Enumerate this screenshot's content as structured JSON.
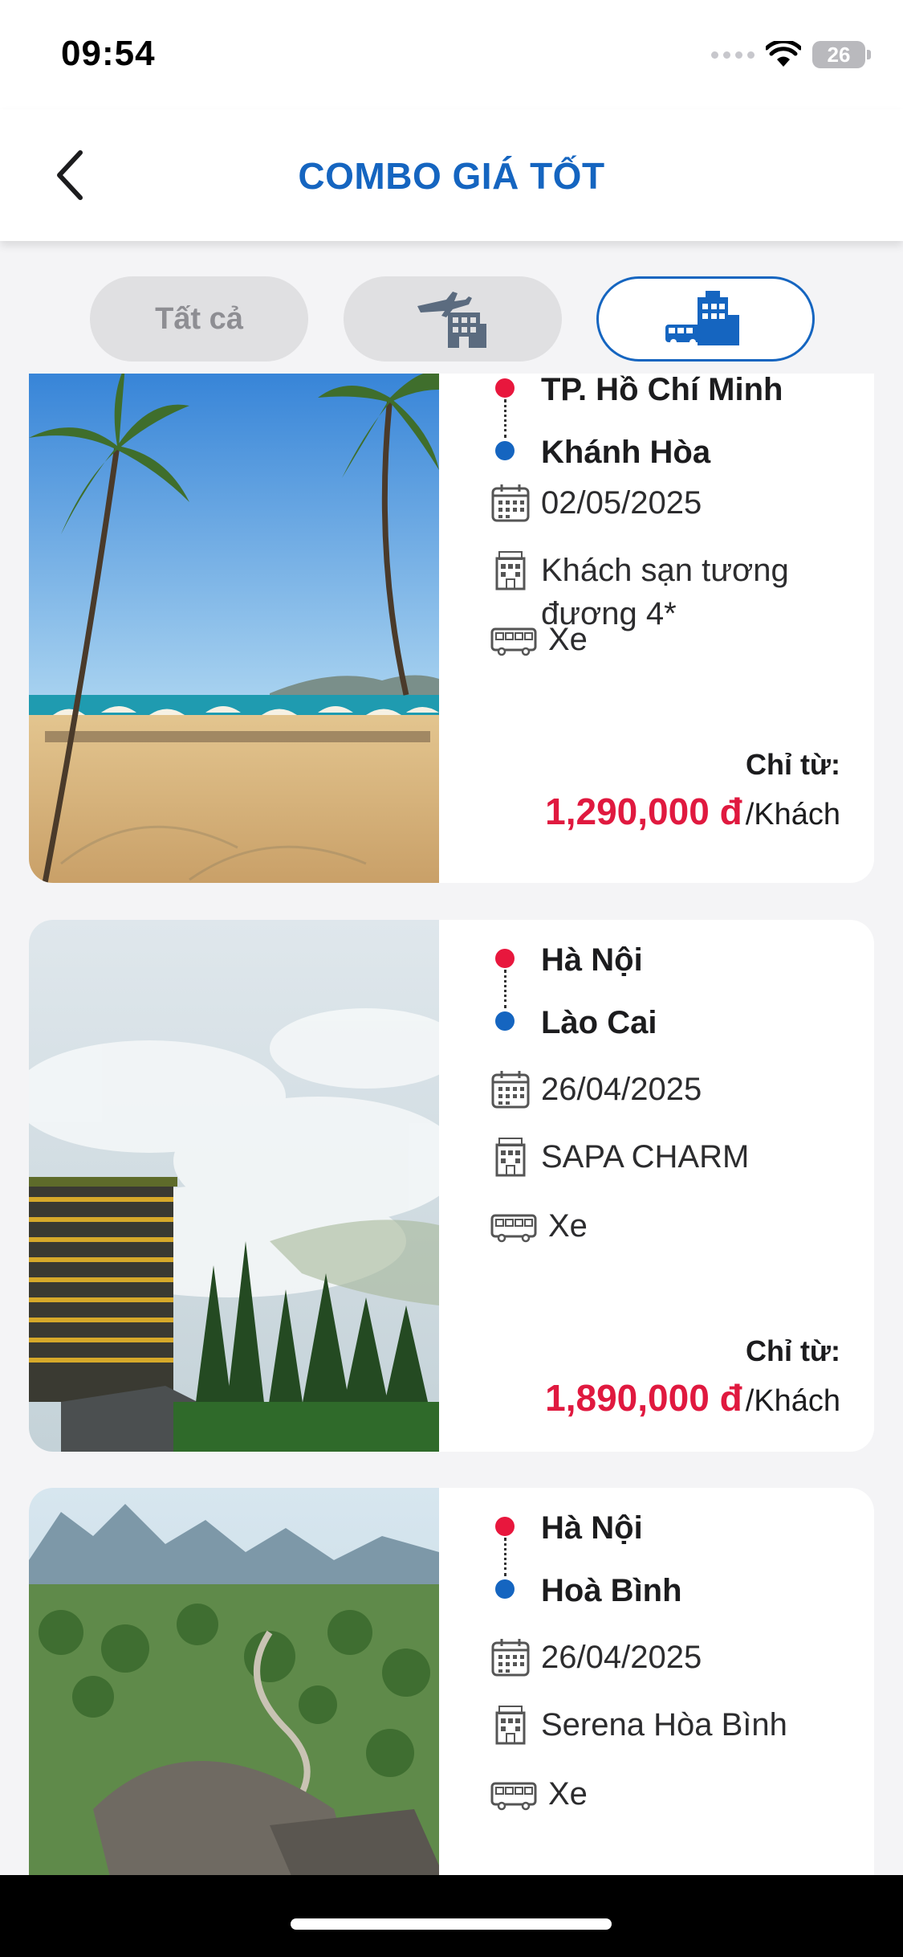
{
  "status_bar": {
    "time": "09:54",
    "battery": "26"
  },
  "header": {
    "title": "COMBO GIÁ TỐT"
  },
  "tabs": [
    {
      "label": "Tất cả",
      "icon": "plane-hotel-icon"
    },
    {
      "icon": "plane-hotel-icon"
    },
    {
      "icon": "bus-hotel-icon",
      "active": true
    }
  ],
  "colors": {
    "brand_blue": "#1565c0",
    "price_red": "#e0193f",
    "origin_dot": "#e8173d"
  },
  "combos": [
    {
      "from": "TP. Hồ Chí Minh",
      "to": "Khánh Hòa",
      "date": "02/05/2025",
      "hotel": "Khách sạn tương đương 4*",
      "transport": "Xe",
      "price_label": "Chỉ từ:",
      "price": "1,290,000 đ",
      "price_unit": "/Khách"
    },
    {
      "from": "Hà Nội",
      "to": "Lào Cai",
      "date": "26/04/2025",
      "hotel": "SAPA CHARM",
      "transport": "Xe",
      "price_label": "Chỉ từ:",
      "price": "1,890,000 đ",
      "price_unit": "/Khách"
    },
    {
      "from": "Hà Nội",
      "to": "Hoà Bình",
      "date": "26/04/2025",
      "hotel": "Serena Hòa Bình",
      "transport": "Xe"
    }
  ]
}
